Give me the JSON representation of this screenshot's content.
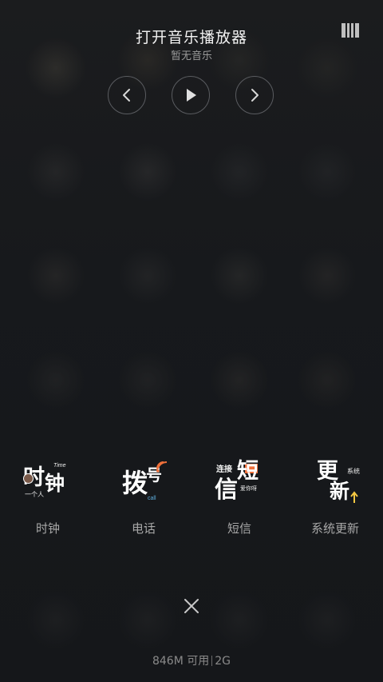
{
  "music": {
    "title": "打开音乐播放器",
    "subtitle": "暂无音乐",
    "controls": {
      "prev_icon": "chevron-left-icon",
      "play_icon": "play-icon",
      "next_icon": "chevron-right-icon",
      "mode_icon": "bars-icon"
    }
  },
  "apps": [
    {
      "label": "时钟",
      "icon": "clock-app-icon",
      "art": {
        "a": "时",
        "b": "钟",
        "tag": "Time",
        "sub": "一个人"
      }
    },
    {
      "label": "电话",
      "icon": "phone-app-icon",
      "art": {
        "a": "拨",
        "b": "号",
        "tag": "call"
      }
    },
    {
      "label": "短信",
      "icon": "messages-app-icon",
      "art": {
        "a": "短",
        "b": "信",
        "tag": "连接",
        "sub": "爱你呀"
      }
    },
    {
      "label": "系统更新",
      "icon": "system-update-app-icon",
      "art": {
        "a": "更",
        "b": "新",
        "tag": "系统"
      }
    }
  ],
  "bottom": {
    "close_icon": "close-icon",
    "memory": "846M 可用",
    "memory_total": "2G"
  },
  "colors": {
    "background": "#16181c",
    "accent_orange": "#f0703a",
    "accent_yellow": "#f5c842"
  }
}
